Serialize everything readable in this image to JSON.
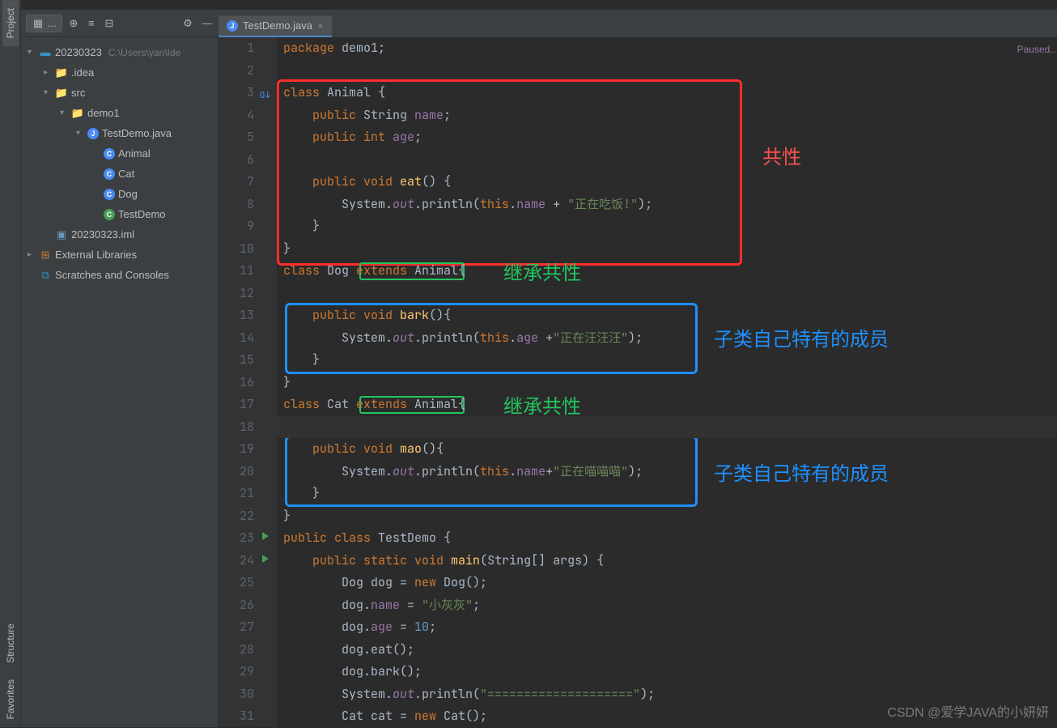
{
  "ide": {
    "leftTabs": {
      "project": "Project",
      "structure": "Structure",
      "favorites": "Favorites"
    },
    "statusRight": "Paused..",
    "watermark": "CSDN @爱学JAVA的小妍妍"
  },
  "toolbar": {
    "selectorIcon": "⊞"
  },
  "tree": {
    "rootName": "20230323",
    "rootPath": "C:\\Users\\yan\\Ide",
    "items": [
      {
        "indent": 0,
        "arrow": "▾",
        "icon": "proj",
        "label": "20230323",
        "trail": "C:\\Users\\yan\\Ide"
      },
      {
        "indent": 1,
        "arrow": "▸",
        "icon": "folder",
        "label": ".idea"
      },
      {
        "indent": 1,
        "arrow": "▾",
        "icon": "folder",
        "label": "src"
      },
      {
        "indent": 2,
        "arrow": "▾",
        "icon": "folder",
        "label": "demo1"
      },
      {
        "indent": 3,
        "arrow": "▾",
        "icon": "java",
        "label": "TestDemo.java"
      },
      {
        "indent": 4,
        "arrow": "",
        "icon": "class",
        "label": "Animal"
      },
      {
        "indent": 4,
        "arrow": "",
        "icon": "class",
        "label": "Cat"
      },
      {
        "indent": 4,
        "arrow": "",
        "icon": "class",
        "label": "Dog"
      },
      {
        "indent": 4,
        "arrow": "",
        "icon": "classrun",
        "label": "TestDemo"
      },
      {
        "indent": 1,
        "arrow": "",
        "icon": "iml",
        "label": "20230323.iml"
      },
      {
        "indent": 0,
        "arrow": "▸",
        "icon": "lib",
        "label": "External Libraries"
      },
      {
        "indent": 0,
        "arrow": "",
        "icon": "scratch",
        "label": "Scratches and Consoles"
      }
    ]
  },
  "tabs": {
    "active": "TestDemo.java"
  },
  "code": {
    "lines": [
      {
        "n": 1,
        "html": "<span class='kw'>package</span> <span class='pkg-stmt'>demo1</span>;"
      },
      {
        "n": 2,
        "html": ""
      },
      {
        "n": 3,
        "html": "<span class='kw'>class</span> Animal {",
        "override": true
      },
      {
        "n": 4,
        "html": "    <span class='kw'>public</span> String <span class='field'>name</span>;"
      },
      {
        "n": 5,
        "html": "    <span class='kw'>public int</span> <span class='field'>age</span>;"
      },
      {
        "n": 6,
        "html": ""
      },
      {
        "n": 7,
        "html": "    <span class='kw'>public void</span> <span class='fn'>eat</span>() {"
      },
      {
        "n": 8,
        "html": "        System.<span class='static'>out</span>.println(<span class='kw'>this</span>.<span class='field'>name</span> + <span class='str'>\"正在吃饭!\"</span>);"
      },
      {
        "n": 9,
        "html": "    }"
      },
      {
        "n": 10,
        "html": "}"
      },
      {
        "n": 11,
        "html": "<span class='kw'>class</span> Dog <span class='kw'>extends</span> Animal{"
      },
      {
        "n": 12,
        "html": ""
      },
      {
        "n": 13,
        "html": "    <span class='kw'>public void</span> <span class='fn'>bark</span>(){"
      },
      {
        "n": 14,
        "html": "        System.<span class='static'>out</span>.println(<span class='kw'>this</span>.<span class='field'>age</span> +<span class='str'>\"正在汪汪汪\"</span>);"
      },
      {
        "n": 15,
        "html": "    }"
      },
      {
        "n": 16,
        "html": "}"
      },
      {
        "n": 17,
        "html": "<span class='kw'>class</span> Cat <span class='kw'>extends</span> Animal{"
      },
      {
        "n": 18,
        "html": "    ",
        "current": true
      },
      {
        "n": 19,
        "html": "    <span class='kw'>public void</span> <span class='fn'>mao</span>(){"
      },
      {
        "n": 20,
        "html": "        System.<span class='static'>out</span>.println(<span class='kw'>this</span>.<span class='field'>name</span>+<span class='str'>\"正在喵喵喵\"</span>);"
      },
      {
        "n": 21,
        "html": "    }"
      },
      {
        "n": 22,
        "html": "}"
      },
      {
        "n": 23,
        "html": "<span class='kw'>public class</span> TestDemo {",
        "run": true
      },
      {
        "n": 24,
        "html": "    <span class='kw'>public static void</span> <span class='fn'>main</span>(String[] args) {",
        "run": true
      },
      {
        "n": 25,
        "html": "        Dog dog = <span class='kw'>new</span> Dog();"
      },
      {
        "n": 26,
        "html": "        dog.<span class='field'>name</span> = <span class='str'>\"小灰灰\"</span>;"
      },
      {
        "n": 27,
        "html": "        dog.<span class='field'>age</span> = <span class='num'>10</span>;"
      },
      {
        "n": 28,
        "html": "        dog.eat();"
      },
      {
        "n": 29,
        "html": "        dog.bark();"
      },
      {
        "n": 30,
        "html": "        System.<span class='static'>out</span>.println(<span class='str'>\"====================\"</span>);"
      },
      {
        "n": 31,
        "html": "        Cat cat = <span class='kw'>new</span> Cat();"
      }
    ]
  },
  "annotations": {
    "redLabel": "共性",
    "greenLabel1": "继承共性",
    "greenLabel2": "继承共性",
    "blueLabel1": "子类自己特有的成员",
    "blueLabel2": "子类自己特有的成员"
  }
}
